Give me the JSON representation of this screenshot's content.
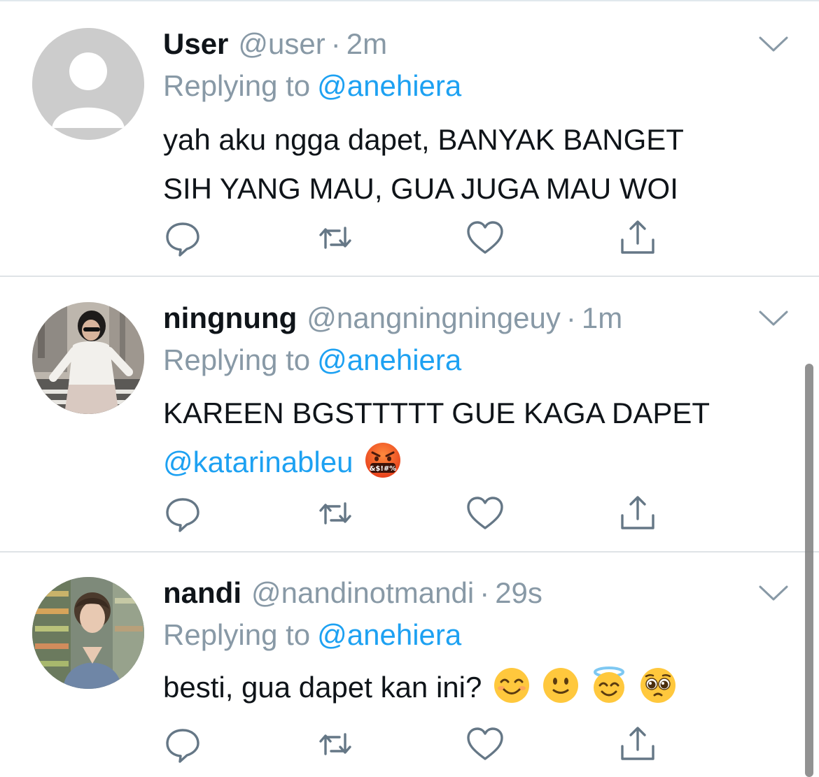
{
  "tweets": [
    {
      "display_name": "User",
      "handle": "@user",
      "separator": "·",
      "time": "2m",
      "replying_label": "Replying to",
      "replying_to": "@anehiera",
      "body_lines": [
        "yah aku ngga dapet, BANYAK BANGET",
        "SIH YANG MAU, GUA JUGA MAU WOI"
      ],
      "avatar": "default-avatar-icon"
    },
    {
      "display_name": "ningnung",
      "handle": "@nangningningeuy",
      "separator": "·",
      "time": "1m",
      "replying_label": "Replying to",
      "replying_to": "@anehiera",
      "body_lines": [
        "KAREEN BGSTTTTT GUE KAGA DAPET"
      ],
      "mention": "@katarinableu",
      "emoji": [
        "face-with-symbols-on-mouth-emoji"
      ],
      "emoji_symbol_text": "&$!#%",
      "avatar": "profile-photo"
    },
    {
      "display_name": "nandi",
      "handle": "@nandinotmandi",
      "separator": "·",
      "time": "29s",
      "replying_label": "Replying to",
      "replying_to": "@anehiera",
      "body_lines": [
        "besti, gua dapet kan ini?"
      ],
      "emoji": [
        "smiling-eyes-emoji",
        "slightly-smiling-emoji",
        "halo-emoji",
        "pleading-face-emoji"
      ],
      "avatar": "profile-photo"
    }
  ],
  "action_icons": [
    "reply-icon",
    "retweet-icon",
    "like-icon",
    "share-icon"
  ],
  "colors": {
    "link": "#1da1f2",
    "muted": "#8899a6",
    "text": "#0f1419",
    "divider": "#dfe3e6",
    "default_avatar": "#cccccc"
  }
}
